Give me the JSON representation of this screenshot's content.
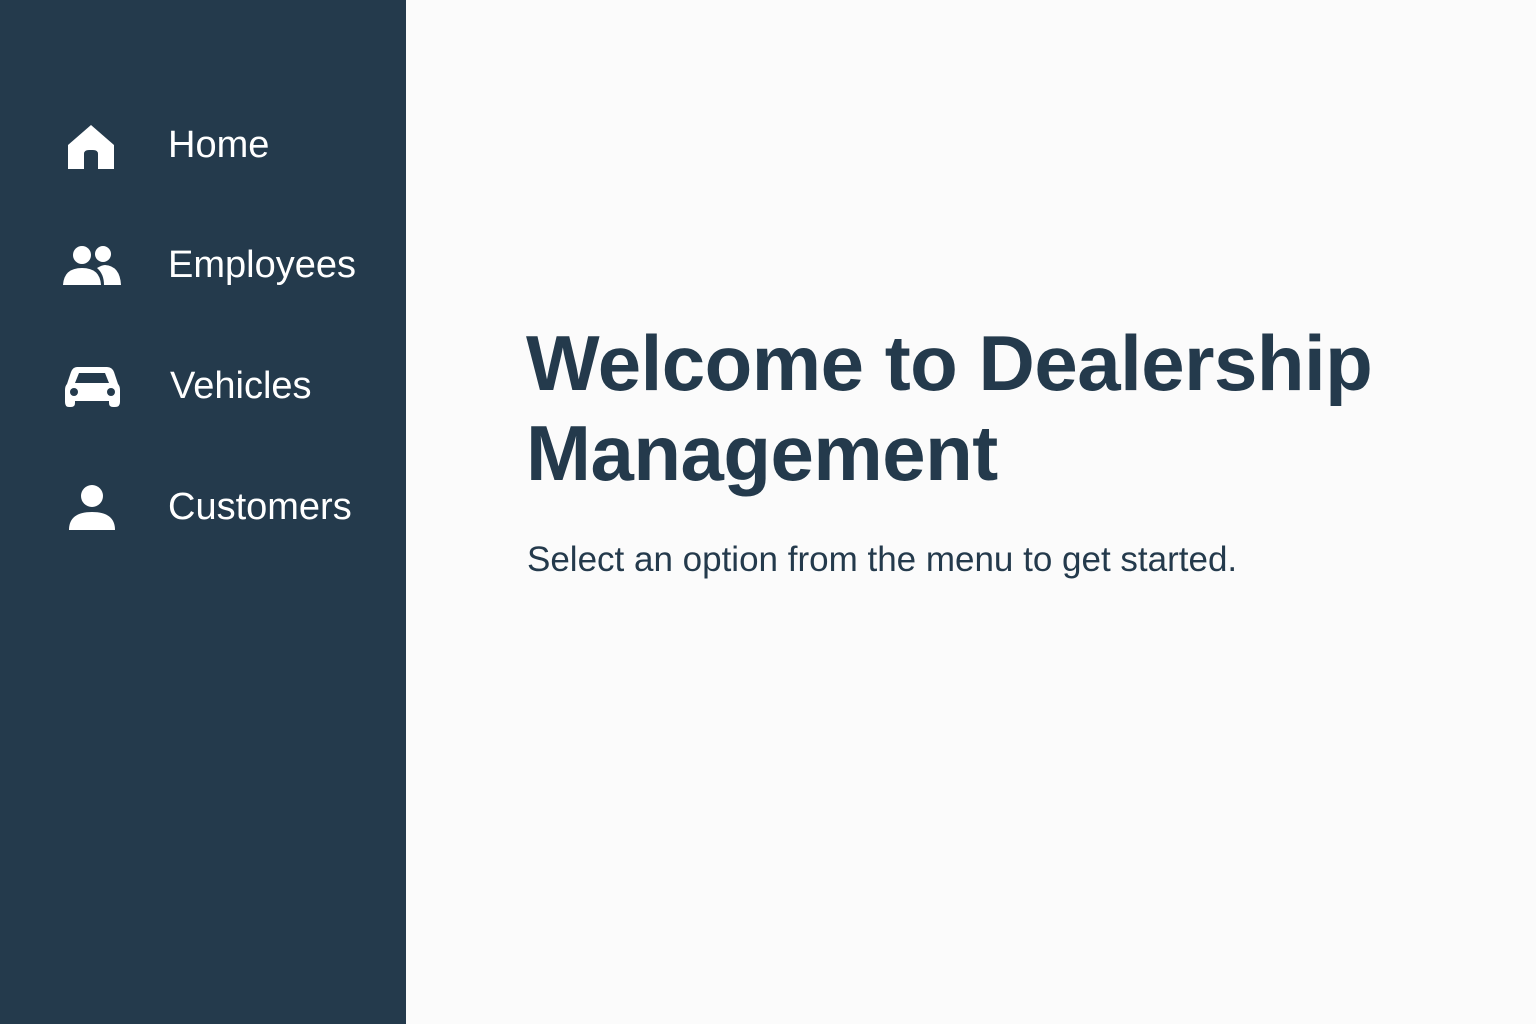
{
  "sidebar": {
    "background_color": "#243a4c",
    "items": [
      {
        "id": "home",
        "label": "Home",
        "icon": "home-icon"
      },
      {
        "id": "employees",
        "label": "Employees",
        "icon": "people-icon"
      },
      {
        "id": "vehicles",
        "label": "Vehicles",
        "icon": "car-icon"
      },
      {
        "id": "customers",
        "label": "Customers",
        "icon": "person-icon"
      }
    ]
  },
  "main": {
    "background_color": "#fbfbfb",
    "title": "Welcome to Dealership Management",
    "subtitle": "Select an option from the menu to get started.",
    "text_color": "#243a4c"
  }
}
